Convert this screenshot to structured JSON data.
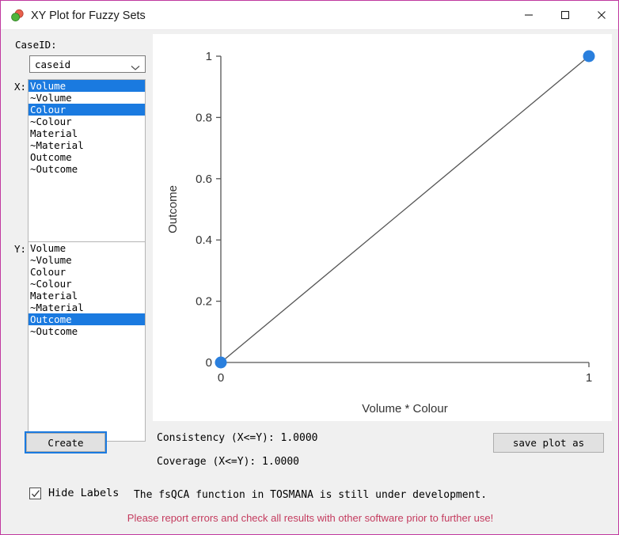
{
  "window": {
    "title": "XY Plot for Fuzzy Sets",
    "icon": "overlapping-circles-icon",
    "accent_border": "#c0399f",
    "controls": {
      "minimize": "minimize-icon",
      "maximize": "maximize-icon",
      "close": "close-icon"
    }
  },
  "sidebar": {
    "caseid_label": "CaseID:",
    "caseid_select": {
      "value": "caseid",
      "options": [
        "caseid"
      ]
    },
    "x_label": "X:",
    "y_label": "Y:",
    "x_list": [
      {
        "label": "Volume",
        "selected": true
      },
      {
        "label": "~Volume",
        "selected": false
      },
      {
        "label": "Colour",
        "selected": true
      },
      {
        "label": "~Colour",
        "selected": false
      },
      {
        "label": "Material",
        "selected": false
      },
      {
        "label": "~Material",
        "selected": false
      },
      {
        "label": "Outcome",
        "selected": false
      },
      {
        "label": "~Outcome",
        "selected": false
      }
    ],
    "y_list": [
      {
        "label": "Volume",
        "selected": false
      },
      {
        "label": "~Volume",
        "selected": false
      },
      {
        "label": "Colour",
        "selected": false
      },
      {
        "label": "~Colour",
        "selected": false
      },
      {
        "label": "Material",
        "selected": false
      },
      {
        "label": "~Material",
        "selected": false
      },
      {
        "label": "Outcome",
        "selected": true
      },
      {
        "label": "~Outcome",
        "selected": false
      }
    ],
    "create_label": "Create",
    "hide_labels_label": "Hide Labels",
    "hide_labels_checked": true,
    "selection_color": "#1a7ae0"
  },
  "results": {
    "consistency": "Consistency (X<=Y): 1.0000",
    "coverage": "Coverage (X<=Y): 1.0000",
    "save_plot_label": "save plot as",
    "dev_notice": "The fsQCA function in TOSMANA is still under development.",
    "error_notice": "Please report errors and check all results with other software prior to further use!",
    "error_color": "#c43b5e"
  },
  "chart_data": {
    "type": "scatter",
    "title": "",
    "xlabel": "Volume * Colour",
    "ylabel": "Outcome",
    "xlim": [
      0,
      1
    ],
    "ylim": [
      0,
      1
    ],
    "x_ticks": [
      0,
      1
    ],
    "x_tick_labels": [
      "0",
      "1"
    ],
    "y_ticks": [
      0,
      0.2,
      0.4,
      0.6,
      0.8,
      1
    ],
    "y_tick_labels": [
      "0",
      "0.2",
      "0.4",
      "0.6",
      "0.8",
      "1"
    ],
    "grid": false,
    "legend": false,
    "point_color": "#2a7fdd",
    "line_color": "#555555",
    "diagonal_line": {
      "from": [
        0,
        0
      ],
      "to": [
        1,
        1
      ]
    },
    "points": [
      {
        "x": 0,
        "y": 0
      },
      {
        "x": 1,
        "y": 1
      }
    ]
  }
}
